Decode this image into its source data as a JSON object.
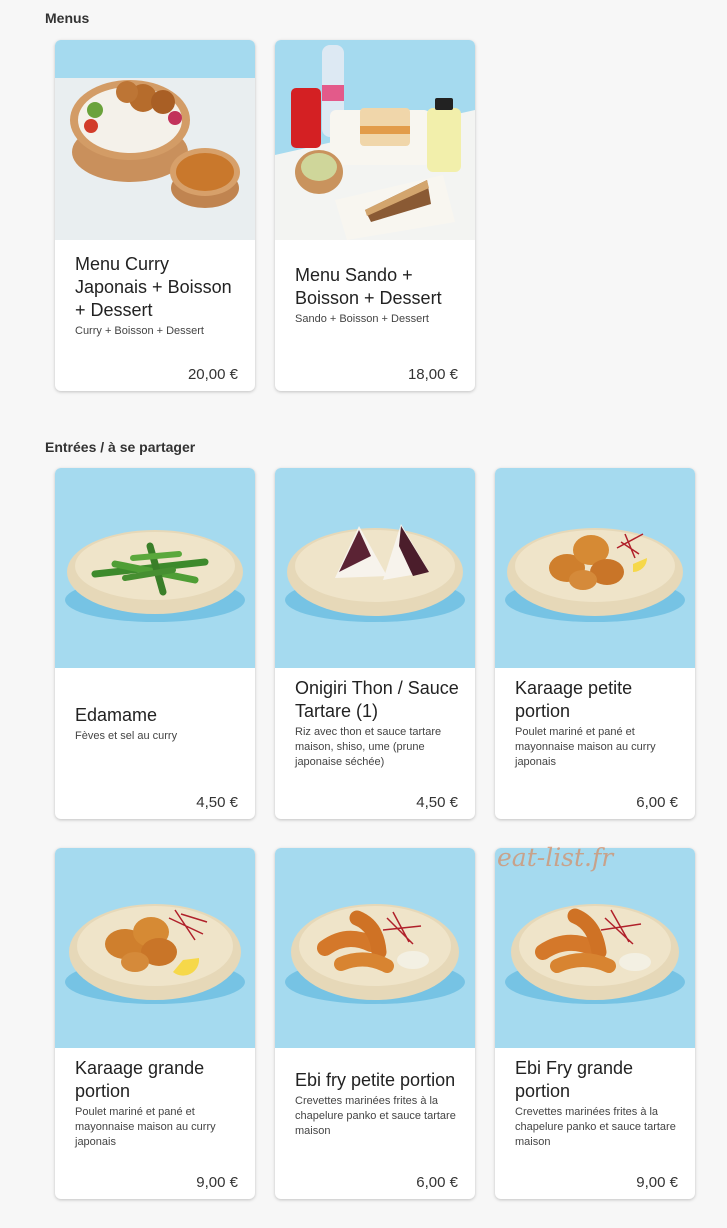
{
  "sections": [
    {
      "title": "Menus",
      "items": [
        {
          "name": "Menu Curry Japonais + Boisson + Dessert",
          "description": "Curry + Boisson + Dessert",
          "price": "20,00 €"
        },
        {
          "name": "Menu Sando + Boisson + Dessert",
          "description": "Sando + Boisson + Dessert",
          "price": "18,00 €"
        }
      ]
    },
    {
      "title": "Entrées / à se partager",
      "items": [
        {
          "name": "Edamame",
          "description": "Fèves et sel au curry",
          "price": "4,50 €"
        },
        {
          "name": "Onigiri Thon / Sauce Tartare (1)",
          "description": "Riz avec thon et sauce tartare maison, shiso, ume (prune japonaise séchée)",
          "price": "4,50 €"
        },
        {
          "name": "Karaage petite portion",
          "description": "Poulet mariné et pané et mayonnaise maison au curry japonais",
          "price": "6,00 €"
        },
        {
          "name": "Karaage grande portion",
          "description": "Poulet mariné et pané et mayonnaise maison au curry japonais",
          "price": "9,00 €"
        },
        {
          "name": "Ebi fry petite portion",
          "description": "Crevettes marinées frites à la chapelure panko et sauce tartare maison",
          "price": "6,00 €"
        },
        {
          "name": "Ebi Fry grande portion",
          "description": "Crevettes marinées frites à la chapelure panko et sauce tartare maison",
          "price": "9,00 €"
        }
      ]
    }
  ],
  "watermark": "eat-list.fr",
  "colors": {
    "photo_background": "#a5daef",
    "plate": "#ece1c8",
    "fried_food": "#cf7f2d"
  }
}
